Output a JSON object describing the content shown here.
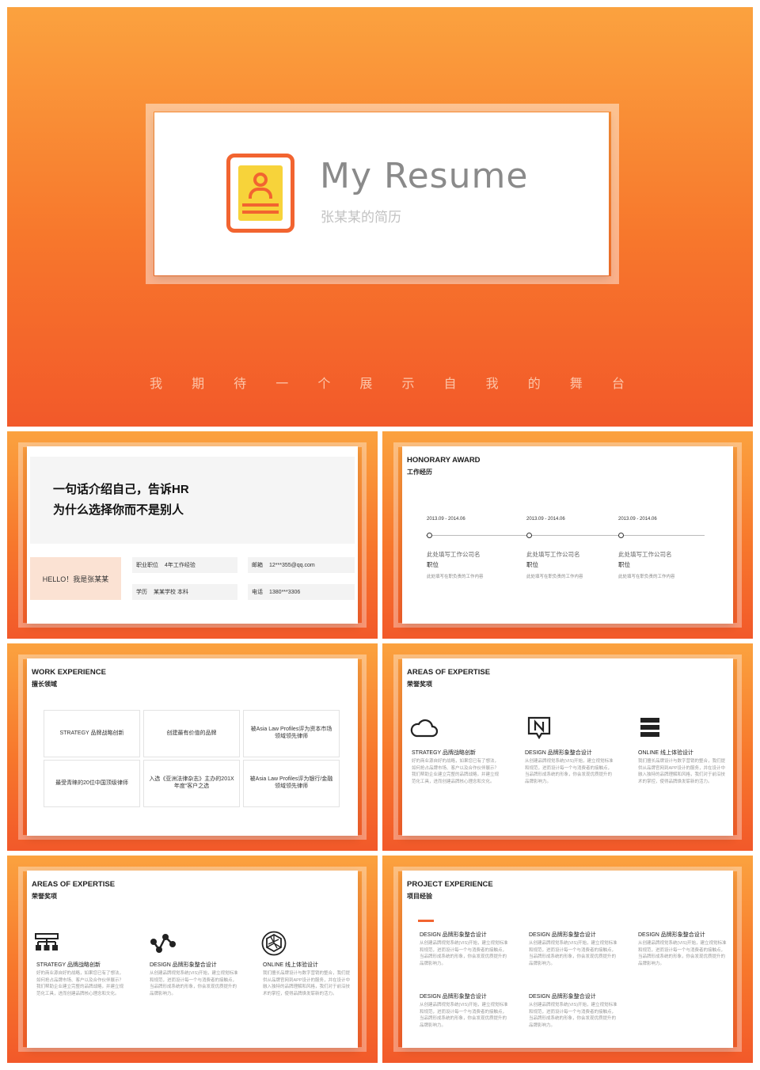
{
  "cover": {
    "title": "My Resume",
    "subtitle": "张某某的简历",
    "tagline": [
      "我",
      "期",
      "待",
      "一",
      "个",
      "展",
      "示",
      "自",
      "我",
      "的",
      "舞",
      "台"
    ]
  },
  "intro": {
    "headline_1": "一句话介绍自己，告诉HR",
    "headline_2": "为什么选择你而不是别人",
    "hello": "HELLO！我是张某某",
    "job_label": "职业职位",
    "job_value": "4年工作经验",
    "email_label": "邮箱",
    "email_value": "12***355@qq.com",
    "edu_label": "学历",
    "edu_value": "某某学校 本科",
    "phone_label": "电话",
    "phone_value": "1380***3306"
  },
  "honorary": {
    "heading": "HONORARY AWARD",
    "subheading": "工作经历",
    "items": [
      {
        "date": "2013.09 - 2014.06",
        "company": "此处填写工作公司名",
        "position": "职位",
        "desc": "此处填写在职负责的工作内容"
      },
      {
        "date": "2013.09 - 2014.06",
        "company": "此处填写工作公司名",
        "position": "职位",
        "desc": "此处填写在职负责的工作内容"
      },
      {
        "date": "2013.09 - 2014.06",
        "company": "此处填写工作公司名",
        "position": "职位",
        "desc": "此处填写在职负责的工作内容"
      }
    ]
  },
  "work": {
    "heading": "WORK EXPERIENCE",
    "subheading": "擅长领域",
    "cells": [
      "STRATEGY 品牌战略创新",
      "创建最有价值的品牌",
      "被Asia Law Profiles评为资本市场领域领先律师",
      "最受青睐的20位中国顶级律师",
      "入选《亚洲法律杂志》主办的201X年度“客户之选",
      "被Asia Law Profiles评为银行/金融领域领先律师"
    ]
  },
  "areas1": {
    "heading": "AREAS OF EXPERTISE",
    "subheading": "荣誉奖项",
    "items": [
      {
        "icon": "cloud-icon",
        "title": "STRATEGY 品牌战略创新",
        "desc": "好的商业源自好的战略，如果您已有了想法，如何抢占品牌市场、客户以及合作伙伴展示？我们帮助企业建立完整的品牌战略，并建立规范化工具，进而创建品牌核心理念和文化。"
      },
      {
        "icon": "chat-n-icon",
        "title": "DESIGN 品牌形象整合设计",
        "desc": "从创建品牌视觉系统(VIS)开始，建立视觉标准和规范，进而设计每一个与消费者的接触点，当品牌形成系统的形象，你会发现优质提升的品牌影响力。"
      },
      {
        "icon": "list-icon",
        "title": "ONLINE 线上体验设计",
        "desc": "我们擅长品牌设计与数字营销的整合，我们提供从品牌官网到APP设计的服务，并在设计中融入独特的品牌理解和风格，我们对于前沿技术的掌控，使得品牌焕发崭新的活力。"
      }
    ]
  },
  "areas2": {
    "heading": "AREAS OF EXPERTISE",
    "subheading": "荣誉奖项",
    "items": [
      {
        "icon": "sitemap-icon",
        "title": "STRATEGY 品牌战略创新",
        "desc": "好的商业源自好的战略，如果您已有了想法，如何抢占品牌市场、客户以及合作伙伴展示？我们帮助企业建立完整的品牌战略，并建立规范化工具，进而创建品牌核心理念和文化。"
      },
      {
        "icon": "share-icon",
        "title": "DESIGN 品牌形象整合设计",
        "desc": "从创建品牌视觉系统(VIS)开始，建立视觉标准和规范，进而设计每一个与消费者的接触点，当品牌形成系统的形象，你会发现优质提升的品牌影响力。"
      },
      {
        "icon": "hexagon-icon",
        "title": "ONLINE 线上体验设计",
        "desc": "我们擅长品牌设计与数字营销的整合，我们提供从品牌官网到APP设计的服务，并在设计中融入独特的品牌理解和风格，我们对于前沿技术的掌控，使得品牌焕发崭新的活力。"
      }
    ]
  },
  "project": {
    "heading": "PROJECT EXPERIENCE",
    "subheading": "项目经验",
    "items": [
      {
        "title": "DESIGN 品牌形象整合设计",
        "desc": "从创建品牌视觉系统(VIS)开始，建立视觉标准和规范，进而设计每一个与消费者的接触点，当品牌形成系统的形象，你会发现优质提升的品牌影响力。"
      },
      {
        "title": "DESIGN 品牌形象整合设计",
        "desc": "从创建品牌视觉系统(VIS)开始，建立视觉标准和规范，进而设计每一个与消费者的接触点，当品牌形成系统的形象，你会发现优质提升的品牌影响力。"
      },
      {
        "title": "DESIGN 品牌形象整合设计",
        "desc": "从创建品牌视觉系统(VIS)开始，建立视觉标准和规范，进而设计每一个与消费者的接触点，当品牌形成系统的形象，你会发现优质提升的品牌影响力。"
      },
      {
        "title": "DESIGN 品牌形象整合设计",
        "desc": "从创建品牌视觉系统(VIS)开始，建立视觉标准和规范，进而设计每一个与消费者的接触点，当品牌形成系统的形象，你会发现优质提升的品牌影响力。"
      },
      {
        "title": "DESIGN 品牌形象整合设计",
        "desc": "从创建品牌视觉系统(VIS)开始，建立视觉标准和规范，进而设计每一个与消费者的接触点，当品牌形成系统的形象，你会发现优质提升的品牌影响力。"
      }
    ]
  },
  "colors": {
    "accent": "#f26430",
    "gradient_top": "#fba23f",
    "gradient_bottom": "#f2592a",
    "hello_bg": "#fbe2d3"
  }
}
